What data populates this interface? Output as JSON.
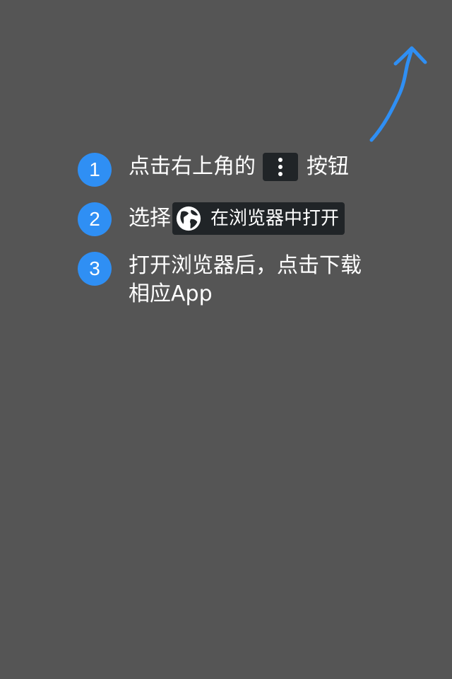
{
  "arrow": {
    "icon": "pointer-arrow-icon",
    "color": "#2f8ff4"
  },
  "steps": [
    {
      "number": "1",
      "before": "点击右上角的",
      "icon": "three-dot-menu-icon",
      "after": "按钮"
    },
    {
      "number": "2",
      "before": "选择",
      "icon": "globe-icon",
      "chip_text": "在浏览器中打开"
    },
    {
      "number": "3",
      "line1": "打开浏览器后，点击下载",
      "line2": "相应App"
    }
  ],
  "colors": {
    "background": "#555555",
    "accent": "#2f8ff4",
    "chip": "#202427",
    "text": "#ffffff"
  }
}
